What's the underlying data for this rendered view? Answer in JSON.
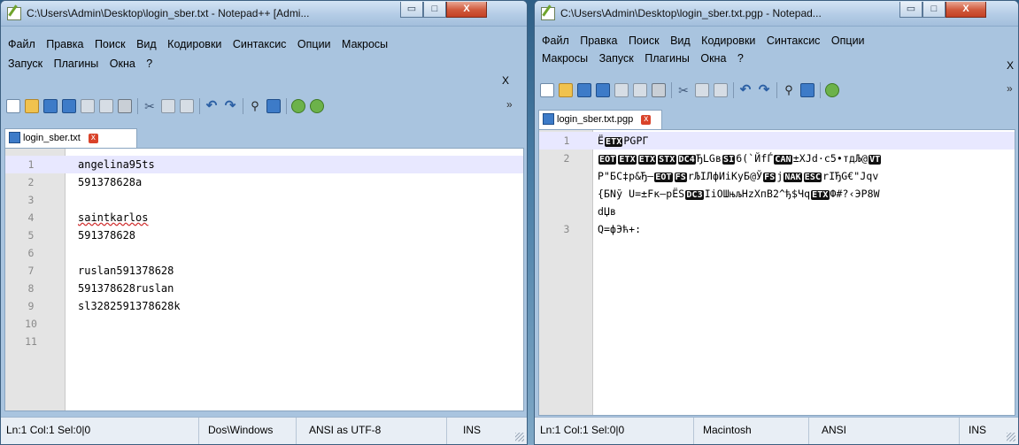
{
  "left_window": {
    "title": "C:\\Users\\Admin\\Desktop\\login_sber.txt - Notepad++ [Admi...",
    "controls": {
      "minimize": "▭",
      "maximize": "□",
      "close": "X"
    },
    "menu": [
      "Файл",
      "Правка",
      "Поиск",
      "Вид",
      "Кодировки",
      "Синтаксис",
      "Опции",
      "Макросы"
    ],
    "menu_row2": [
      "Запуск",
      "Плагины",
      "Окна",
      "?"
    ],
    "menu_close": "X",
    "toolbar_more": "»",
    "tab": {
      "label": "login_sber.txt",
      "close": "x"
    },
    "lines": [
      {
        "n": "1",
        "text": "angelina95ts"
      },
      {
        "n": "2",
        "text": "591378628a"
      },
      {
        "n": "3",
        "text": ""
      },
      {
        "n": "4",
        "text": "saintkarlos"
      },
      {
        "n": "5",
        "text": "591378628"
      },
      {
        "n": "6",
        "text": ""
      },
      {
        "n": "7",
        "text": "ruslan591378628"
      },
      {
        "n": "8",
        "text": "591378628ruslan"
      },
      {
        "n": "9",
        "text": "sl3282591378628k"
      },
      {
        "n": "10",
        "text": ""
      },
      {
        "n": "11",
        "text": ""
      }
    ],
    "status": {
      "pos": "Ln:1   Col:1   Sel:0|0",
      "eol": "Dos\\Windows",
      "encoding": "ANSI as UTF-8",
      "mode": "INS"
    }
  },
  "right_window": {
    "title": "C:\\Users\\Admin\\Desktop\\login_sber.txt.pgp - Notepad...",
    "controls": {
      "minimize": "▭",
      "maximize": "□",
      "close": "X"
    },
    "menu": [
      "Файл",
      "Правка",
      "Поиск",
      "Вид",
      "Кодировки",
      "Синтаксис",
      "Опции"
    ],
    "menu_row2": [
      "Макросы",
      "Запуск",
      "Плагины",
      "Окна",
      "?"
    ],
    "menu_close": "X",
    "toolbar_more": "»",
    "tab": {
      "label": "login_sber.txt.pgp",
      "close": "x"
    },
    "line_numbers": [
      "1",
      "2",
      "3"
    ],
    "line1": {
      "a": "Ё",
      "b1": "ETX",
      "c": "PGPГ"
    },
    "line2a": {
      "b1": "EOT",
      "b2": "ETX",
      "b3": "ETX",
      "b4": "STX",
      "b5": "DC4",
      "t1": "ЂLGв",
      "b6": "SI",
      "t2": "6(`ЙfЃ",
      "b7": "CAN",
      "t3": "±XJd·c5•тдЉ@",
      "b8": "VT"
    },
    "line2b": {
      "t1": "Р\"БС‡р&Ђ–",
      "b1": "EOT",
      "b2": "FS",
      "t2": "rЉIЛфИiКуБ@Ў",
      "b3": "FS",
      "t3": "j",
      "b4": "NAK",
      "b5": "ESC",
      "t4": "rIЂG€\"Jqv"
    },
    "line2c": {
      "t1": "{БNў U=±Fк—рЁS",
      "b1": "DC3",
      "t2": "IiОШњљHzXпВ2^ђ$Чq",
      "b2": "ETX",
      "t3": "Ф#?‹ЭР8W"
    },
    "line2d": {
      "t1": "dЏв"
    },
    "line3": {
      "t1": "Q=фЭћ+:"
    },
    "status": {
      "pos": "Ln:1   Col:1   Sel:0|0",
      "eol": "Macintosh",
      "encoding": "ANSI",
      "mode": "INS"
    }
  }
}
